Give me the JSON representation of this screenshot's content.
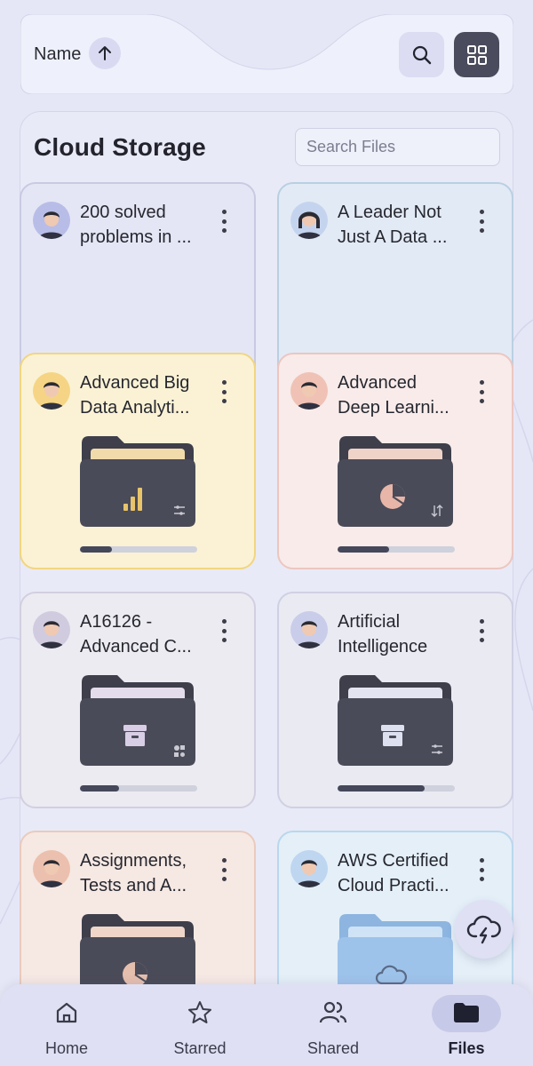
{
  "topbar": {
    "sort_label": "Name",
    "sort_icon": "arrow-up-icon",
    "search_icon": "search-icon",
    "view_icon": "grid-view-icon"
  },
  "panel": {
    "title": "Cloud Storage",
    "search_placeholder": "Search Files"
  },
  "cards": [
    {
      "title": "200 solved\nproblems in ...",
      "bg": "#e5e6f5",
      "border": "#c9cae2",
      "avatar_bg": "#b8bde8",
      "avatar_type": "man",
      "has_folder": false
    },
    {
      "title": "A Leader Not\nJust A Data ...",
      "bg": "#e2eaf5",
      "border": "#b9d0e2",
      "avatar_bg": "#c5d4ee",
      "avatar_type": "woman",
      "has_folder": false
    },
    {
      "title": "Advanced Big\nData Analyti...",
      "bg": "#fbf2d5",
      "border": "#f1d680",
      "avatar_bg": "#f5d585",
      "avatar_type": "man",
      "has_folder": true,
      "folder_paper": "#f1dbaa",
      "folder_icon": "bar-chart-icon",
      "folder_icon_color": "#e8c46a",
      "corner_icon": "sliders-icon",
      "progress": 0.27
    },
    {
      "title": "Advanced\nDeep Learni...",
      "bg": "#f8ebea",
      "border": "#ecc6c0",
      "avatar_bg": "#f0c2b5",
      "avatar_type": "man",
      "has_folder": true,
      "folder_paper": "#efd3c8",
      "folder_icon": "pie-chart-icon",
      "folder_icon_color": "#e7b6a8",
      "corner_icon": "sort-icon",
      "progress": 0.44
    },
    {
      "title": "A16126 -\nAdvanced C...",
      "bg": "#ecebf2",
      "border": "#d2cfe0",
      "avatar_bg": "#d1cbe0",
      "avatar_type": "man",
      "has_folder": true,
      "folder_paper": "#e4dceb",
      "folder_icon": "archive-box-icon",
      "folder_icon_color": "#d8cfe6",
      "corner_icon": "shapes-icon",
      "progress": 0.33
    },
    {
      "title": "Artificial\nIntelligence",
      "bg": "#eaeaf3",
      "border": "#cfd0e3",
      "avatar_bg": "#c9cde9",
      "avatar_type": "man",
      "has_folder": true,
      "folder_paper": "#e3e4f0",
      "folder_icon": "archive-box-icon",
      "folder_icon_color": "#dde0ee",
      "corner_icon": "sliders-icon",
      "progress": 0.74
    },
    {
      "title": "Assignments,\nTests and A...",
      "bg": "#f6e8e3",
      "border": "#e9cbbd",
      "avatar_bg": "#ecc0ae",
      "avatar_type": "man",
      "has_folder": true,
      "folder_paper": "#efd6c8",
      "folder_icon": "pie-chart-icon",
      "folder_icon_color": "#e5bfae",
      "corner_icon": "",
      "progress": 0
    },
    {
      "title": "AWS Certified\nCloud Practi...",
      "bg": "#e4eff8",
      "border": "#b9d8ec",
      "avatar_bg": "#bed6f0",
      "avatar_type": "man",
      "has_folder": true,
      "folder_color": "#9ec3ea",
      "folder_paper": "#cfe3f6",
      "folder_icon": "cloud-icon",
      "folder_icon_color": "#5a6b86",
      "corner_icon": "",
      "progress": 0
    }
  ],
  "fab": {
    "icon": "cloud-lightning-icon"
  },
  "nav": [
    {
      "label": "Home",
      "icon": "home-icon",
      "active": false
    },
    {
      "label": "Starred",
      "icon": "star-icon",
      "active": false
    },
    {
      "label": "Shared",
      "icon": "people-icon",
      "active": false
    },
    {
      "label": "Files",
      "icon": "folder-icon",
      "active": true
    }
  ]
}
